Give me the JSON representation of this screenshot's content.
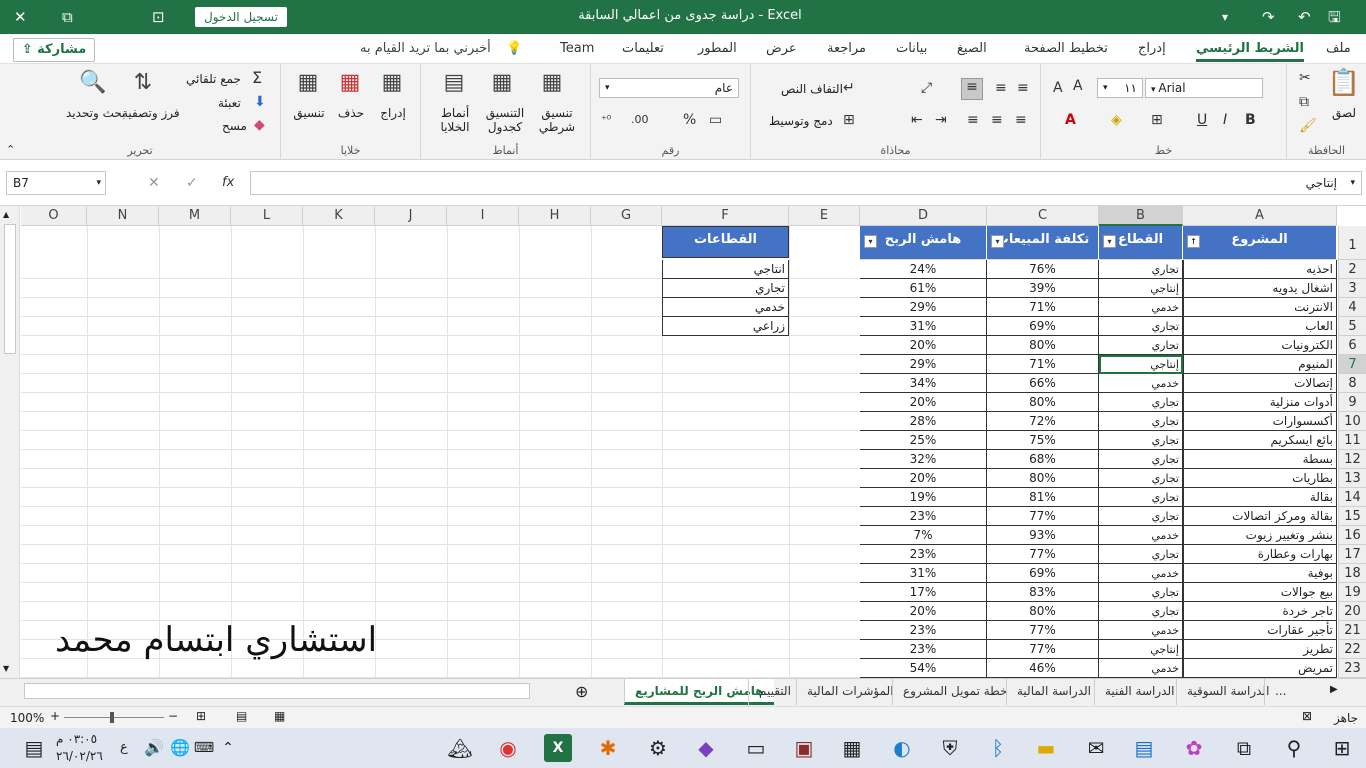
{
  "titlebar": {
    "doc_title": "دراسة جدوى من اعمالي السابقة  -  Excel",
    "signin": "تسجيل الدخول",
    "close": "✕",
    "restore": "⧉",
    "ribbon_display": "⊡"
  },
  "tabs": {
    "share": "مشاركة",
    "items": [
      "ملف",
      "الشريط الرئيسي",
      "إدراج",
      "تخطيط الصفحة",
      "الصيغ",
      "بيانات",
      "مراجعة",
      "عرض",
      "المطور",
      "تعليمات",
      "Team"
    ],
    "tellme": "أخبرني بما تريد القيام به"
  },
  "ribbon": {
    "clipboard": {
      "label": "الحافظة",
      "paste": "لصق"
    },
    "font": {
      "label": "خط",
      "name": "Arial",
      "size": "١١",
      "bold": "B",
      "italic": "I",
      "underline": "U"
    },
    "alignment": {
      "label": "محاذاة",
      "wrap": "التفاف النص",
      "merge": "دمج وتوسيط"
    },
    "number": {
      "label": "رقم",
      "format": "عام",
      "percent": "%"
    },
    "styles": {
      "label": "أنماط",
      "conditional": "تنسيق شرطي",
      "table": "التنسيق كجدول",
      "cell": "أنماط الخلايا"
    },
    "cells": {
      "label": "خلايا",
      "insert": "إدراج",
      "delete": "حذف",
      "format": "تنسيق"
    },
    "editing": {
      "label": "تحرير",
      "autosum": "جمع تلقائي",
      "fill": "تعبئة",
      "clear": "مسح",
      "sort": "فرز وتصفية",
      "find": "بحث وتحديد"
    }
  },
  "formula": {
    "namebox": "B7",
    "content": "إنتاجي",
    "fx": "fx"
  },
  "grid": {
    "col_letters": [
      "A",
      "B",
      "C",
      "D",
      "E",
      "F",
      "G",
      "H",
      "I",
      "J",
      "K",
      "L",
      "M",
      "N",
      "O"
    ],
    "headers": {
      "A": "المشروع",
      "B": "القطاع",
      "C": "تكلفة المبيعات",
      "D": "هامش الربح"
    },
    "rows": [
      {
        "n": "2",
        "a": "احذيه",
        "b": "تجاري",
        "c": "76%",
        "d": "24%"
      },
      {
        "n": "3",
        "a": "اشغال يدويه",
        "b": "إنتاجي",
        "c": "39%",
        "d": "61%"
      },
      {
        "n": "4",
        "a": "الانترنت",
        "b": "خدمي",
        "c": "71%",
        "d": "29%"
      },
      {
        "n": "5",
        "a": "العاب",
        "b": "تجاري",
        "c": "69%",
        "d": "31%"
      },
      {
        "n": "6",
        "a": "الكترونيات",
        "b": "تجاري",
        "c": "80%",
        "d": "20%"
      },
      {
        "n": "7",
        "a": "المنيوم",
        "b": "إنتاجي",
        "c": "71%",
        "d": "29%"
      },
      {
        "n": "8",
        "a": "إتصالات",
        "b": "خدمي",
        "c": "66%",
        "d": "34%"
      },
      {
        "n": "9",
        "a": "أدوات منزلية",
        "b": "تجاري",
        "c": "80%",
        "d": "20%"
      },
      {
        "n": "10",
        "a": "أكسسوارات",
        "b": "تجاري",
        "c": "72%",
        "d": "28%"
      },
      {
        "n": "11",
        "a": "بائع ايسكريم",
        "b": "تجاري",
        "c": "75%",
        "d": "25%"
      },
      {
        "n": "12",
        "a": "بسطة",
        "b": "تجاري",
        "c": "68%",
        "d": "32%"
      },
      {
        "n": "13",
        "a": "بطاريات",
        "b": "تجاري",
        "c": "80%",
        "d": "20%"
      },
      {
        "n": "14",
        "a": "بقالة",
        "b": "تجاري",
        "c": "81%",
        "d": "19%"
      },
      {
        "n": "15",
        "a": "بقالة ومركز اتصالات",
        "b": "تجاري",
        "c": "77%",
        "d": "23%"
      },
      {
        "n": "16",
        "a": "بنشر وتغيير زيوت",
        "b": "خدمي",
        "c": "93%",
        "d": "7%"
      },
      {
        "n": "17",
        "a": "بهارات وعطارة",
        "b": "تجاري",
        "c": "77%",
        "d": "23%"
      },
      {
        "n": "18",
        "a": "بوفية",
        "b": "خدمي",
        "c": "69%",
        "d": "31%"
      },
      {
        "n": "19",
        "a": "بيع جوالات",
        "b": "تجاري",
        "c": "83%",
        "d": "17%"
      },
      {
        "n": "20",
        "a": "تاجر خردة",
        "b": "تجاري",
        "c": "80%",
        "d": "20%"
      },
      {
        "n": "21",
        "a": "تأجير عقارات",
        "b": "خدمي",
        "c": "77%",
        "d": "23%"
      },
      {
        "n": "22",
        "a": "تطريز",
        "b": "إنتاجي",
        "c": "77%",
        "d": "23%"
      },
      {
        "n": "23",
        "a": "تمريض",
        "b": "خدمي",
        "c": "46%",
        "d": "54%"
      }
    ],
    "sectors_header": "القطاعات",
    "sectors": [
      "انتاجي",
      "تجاري",
      "خدمي",
      "زراعي"
    ]
  },
  "signature": "استشاري ابتسام محمد",
  "sheets": {
    "items": [
      "الدراسة السوقية",
      "الدراسة الفنية",
      "الدراسة المالية",
      "خطة تمويل المشروع",
      "المؤشرات المالية",
      "التقييم",
      "هامش الربح للمشاريع"
    ],
    "more": "..."
  },
  "status": {
    "ready": "جاهز",
    "zoom": "100%"
  },
  "taskbar": {
    "time": "٠٣:٠٥ م",
    "date": "٢٦/٠٢/٢٦",
    "lang": "ع"
  }
}
